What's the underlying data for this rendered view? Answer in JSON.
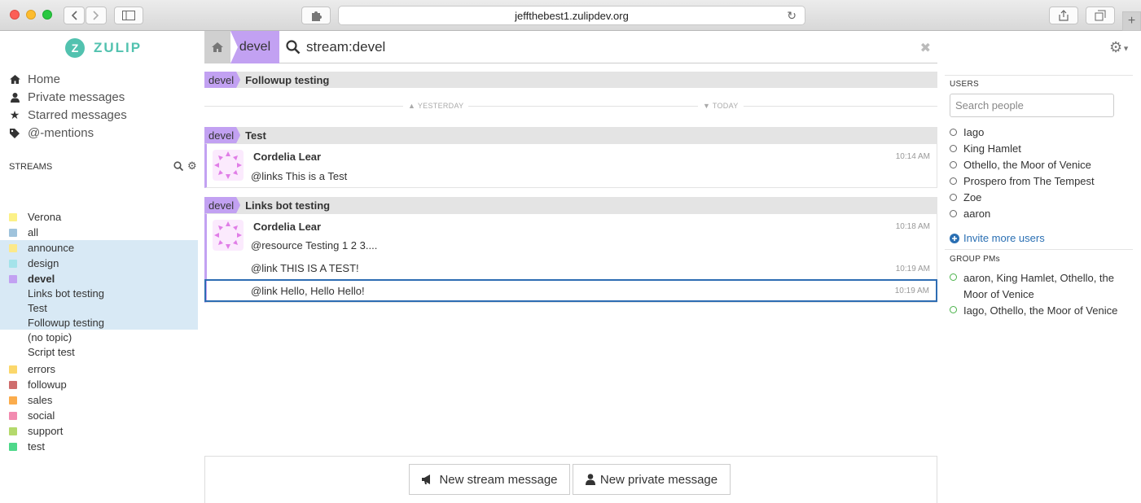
{
  "browser": {
    "url": "jeffthebest1.zulipdev.org"
  },
  "brand": {
    "name": "ZULIP",
    "mark": "Z",
    "color": "#52c2af"
  },
  "searchbar": {
    "stream_tab": "devel",
    "query": "stream:devel"
  },
  "nav": [
    {
      "label": "Home",
      "icon": "home-icon"
    },
    {
      "label": "Private messages",
      "icon": "user-icon"
    },
    {
      "label": "Starred messages",
      "icon": "star-icon"
    },
    {
      "label": "@-mentions",
      "icon": "tag-icon"
    }
  ],
  "streams": {
    "title": "STREAMS",
    "items": [
      {
        "name": "Verona",
        "color": "#fcf187"
      },
      {
        "name": "all",
        "color": "#9fc3dc"
      },
      {
        "name": "announce",
        "color": "#fce98a"
      },
      {
        "name": "design",
        "color": "#a4e3ea"
      },
      {
        "name": "devel",
        "color": "#c2a1f2"
      },
      {
        "name": "errors",
        "color": "#fbd76b"
      },
      {
        "name": "followup",
        "color": "#cf6d6d"
      },
      {
        "name": "sales",
        "color": "#fbac4c"
      },
      {
        "name": "social",
        "color": "#f28bb0"
      },
      {
        "name": "support",
        "color": "#b4d96c"
      },
      {
        "name": "test",
        "color": "#4ed88a"
      }
    ],
    "devel_topics": [
      "Links bot testing",
      "Test",
      "Followup testing",
      "(no topic)",
      "Script test"
    ]
  },
  "feed": {
    "day_yesterday": "YESTERDAY",
    "day_today": "TODAY",
    "groups": [
      {
        "stream": "devel",
        "topic": "Followup testing"
      },
      {
        "stream": "devel",
        "topic": "Test"
      },
      {
        "stream": "devel",
        "topic": "Links bot testing"
      }
    ],
    "msg_test": {
      "sender": "Cordelia Lear",
      "content": "@links This is a Test",
      "time": "10:14 AM"
    },
    "msgs_links": [
      {
        "sender": "Cordelia Lear",
        "content": "@resource Testing 1 2 3....",
        "time": "10:18 AM"
      },
      {
        "content": "@link THIS IS A TEST!",
        "time": "10:19 AM"
      },
      {
        "content": "@link Hello, Hello Hello!",
        "time": "10:19 AM"
      }
    ]
  },
  "compose": {
    "stream_btn": "New stream message",
    "private_btn": "New private message"
  },
  "rightbar": {
    "users_title": "USERS",
    "search_placeholder": "Search people",
    "users": [
      "Iago",
      "King Hamlet",
      "Othello, the Moor of Venice",
      "Prospero from The Tempest",
      "Zoe",
      "aaron"
    ],
    "invite": "Invite more users",
    "group_title": "GROUP PMs",
    "group_pms": [
      "aaron, King Hamlet, Othello, the Moor of Venice",
      "Iago, Othello, the Moor of Venice"
    ]
  }
}
